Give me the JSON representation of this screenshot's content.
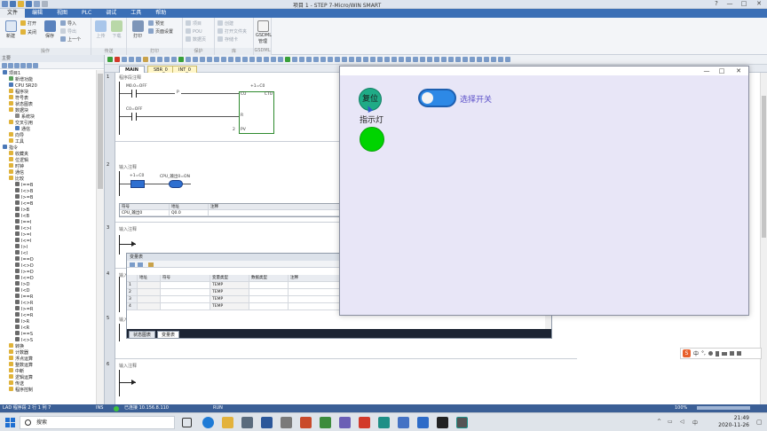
{
  "window": {
    "title": "项目 1 - STEP 7-Micro/WIN SMART",
    "controls": {
      "help": "?",
      "minimize": "—",
      "maximize": "□",
      "close": "✕"
    }
  },
  "menubar": {
    "items": [
      "文件",
      "编辑",
      "视图",
      "PLC",
      "调试",
      "工具",
      "帮助"
    ],
    "active_index": 0
  },
  "ribbon": {
    "new": "新建",
    "open": "打开",
    "close": "关闭",
    "save": "保存",
    "import": "导入",
    "export": "导出",
    "previous": "上一个",
    "group_ops": "操作",
    "upload": "上传",
    "download": "下载",
    "group_transfer": "传送",
    "print": "打印",
    "preview": "预览",
    "page_setup": "页面设置",
    "group_print": "打印",
    "protect_pou": "POU",
    "protect_data": "数据页",
    "protect_project": "项目",
    "group_protect": "保护",
    "create": "创建",
    "open_library": "打开文件夹",
    "storage": "存储卡",
    "group_library": "库",
    "gsdml": "GSDML 管理",
    "group_gsdml": "GSDML"
  },
  "project_panel": {
    "header": "主要",
    "tree": [
      {
        "label": "项目1",
        "level": 0,
        "color": "#4a78b8"
      },
      {
        "label": "新增功能",
        "level": 1,
        "color": "#5aa05a"
      },
      {
        "label": "CPU SR20",
        "level": 1,
        "color": "#4a78b8"
      },
      {
        "label": "程序块",
        "level": 1,
        "color": "#e0b33a"
      },
      {
        "label": "符号表",
        "level": 1,
        "color": "#e0b33a"
      },
      {
        "label": "状态图表",
        "level": 1,
        "color": "#e0b33a"
      },
      {
        "label": "数据块",
        "level": 1,
        "color": "#e0b33a"
      },
      {
        "label": "系统块",
        "level": 2,
        "color": "#888888"
      },
      {
        "label": "交叉引用",
        "level": 1,
        "color": "#e0b33a"
      },
      {
        "label": "通信",
        "level": 2,
        "color": "#4a78b8"
      },
      {
        "label": "向导",
        "level": 1,
        "color": "#e0b33a"
      },
      {
        "label": "工具",
        "level": 1,
        "color": "#e0b33a"
      },
      {
        "label": "指令",
        "level": 0,
        "color": "#4a78b8"
      },
      {
        "label": "收藏夹",
        "level": 1,
        "color": "#e0b33a"
      },
      {
        "label": "位逻辑",
        "level": 1,
        "color": "#e0b33a"
      },
      {
        "label": "时钟",
        "level": 1,
        "color": "#e0b33a"
      },
      {
        "label": "通信",
        "level": 1,
        "color": "#e0b33a"
      },
      {
        "label": "比较",
        "level": 1,
        "color": "#e0b33a"
      },
      {
        "label": "I==B",
        "level": 2,
        "color": "#6a6a6a"
      },
      {
        "label": "I<>B",
        "level": 2,
        "color": "#6a6a6a"
      },
      {
        "label": "I>=B",
        "level": 2,
        "color": "#6a6a6a"
      },
      {
        "label": "I<=B",
        "level": 2,
        "color": "#6a6a6a"
      },
      {
        "label": "I>B",
        "level": 2,
        "color": "#6a6a6a"
      },
      {
        "label": "I<B",
        "level": 2,
        "color": "#6a6a6a"
      },
      {
        "label": "I==I",
        "level": 2,
        "color": "#6a6a6a"
      },
      {
        "label": "I<>I",
        "level": 2,
        "color": "#6a6a6a"
      },
      {
        "label": "I>=I",
        "level": 2,
        "color": "#6a6a6a"
      },
      {
        "label": "I<=I",
        "level": 2,
        "color": "#6a6a6a"
      },
      {
        "label": "I>I",
        "level": 2,
        "color": "#6a6a6a"
      },
      {
        "label": "I<I",
        "level": 2,
        "color": "#6a6a6a"
      },
      {
        "label": "I==D",
        "level": 2,
        "color": "#6a6a6a"
      },
      {
        "label": "I<>D",
        "level": 2,
        "color": "#6a6a6a"
      },
      {
        "label": "I>=D",
        "level": 2,
        "color": "#6a6a6a"
      },
      {
        "label": "I<=D",
        "level": 2,
        "color": "#6a6a6a"
      },
      {
        "label": "I>D",
        "level": 2,
        "color": "#6a6a6a"
      },
      {
        "label": "I<D",
        "level": 2,
        "color": "#6a6a6a"
      },
      {
        "label": "I==R",
        "level": 2,
        "color": "#6a6a6a"
      },
      {
        "label": "I<>R",
        "level": 2,
        "color": "#6a6a6a"
      },
      {
        "label": "I>=R",
        "level": 2,
        "color": "#6a6a6a"
      },
      {
        "label": "I<=R",
        "level": 2,
        "color": "#6a6a6a"
      },
      {
        "label": "I>R",
        "level": 2,
        "color": "#6a6a6a"
      },
      {
        "label": "I<R",
        "level": 2,
        "color": "#6a6a6a"
      },
      {
        "label": "I==S",
        "level": 2,
        "color": "#6a6a6a"
      },
      {
        "label": "I<>S",
        "level": 2,
        "color": "#6a6a6a"
      },
      {
        "label": "转换",
        "level": 1,
        "color": "#e0b33a"
      },
      {
        "label": "计数器",
        "level": 1,
        "color": "#e0b33a"
      },
      {
        "label": "浮点运算",
        "level": 1,
        "color": "#e0b33a"
      },
      {
        "label": "整数运算",
        "level": 1,
        "color": "#e0b33a"
      },
      {
        "label": "中断",
        "level": 1,
        "color": "#e0b33a"
      },
      {
        "label": "逻辑运算",
        "level": 1,
        "color": "#e0b33a"
      },
      {
        "label": "传送",
        "level": 1,
        "color": "#e0b33a"
      },
      {
        "label": "程序控制",
        "level": 1,
        "color": "#e0b33a"
      }
    ]
  },
  "editor": {
    "tabs": [
      {
        "label": "MAIN",
        "active": true
      },
      {
        "label": "SBR_0",
        "active": false
      },
      {
        "label": "INT_0",
        "active": false
      }
    ],
    "networks": [
      {
        "num": "1",
        "comment": "程序段注释",
        "contact1": "M0.0=OFF",
        "contact1_tag": "P",
        "contact2": "C0=OFF",
        "counter_value": "+1=C0",
        "counter_type": "CTU",
        "pin_cu": "CU",
        "pin_r": "R",
        "pin_pv": "PV",
        "pv_value": "2"
      },
      {
        "num": "2",
        "comment": "输入注释",
        "contact": "+1=C0",
        "coil": "CPU_输出0=ON",
        "symtable": {
          "headers": [
            "符号",
            "地址",
            "注释"
          ],
          "rows": [
            [
              "CPU_输出0",
              "Q0.0",
              ""
            ]
          ]
        }
      },
      {
        "num": "3",
        "comment": "输入注释"
      },
      {
        "num": "4",
        "comment": "输入注释"
      },
      {
        "num": "5",
        "comment": "输入注释"
      },
      {
        "num": "6",
        "comment": "输入注释"
      }
    ]
  },
  "var_table": {
    "title": "变量表",
    "headers": [
      "",
      "地址",
      "符号",
      "变量类型",
      "数据类型",
      "注释"
    ],
    "rows": [
      {
        "n": "1",
        "type": "TEMP"
      },
      {
        "n": "2",
        "type": "TEMP"
      },
      {
        "n": "3",
        "type": "TEMP"
      },
      {
        "n": "4",
        "type": "TEMP"
      }
    ],
    "bottom_tabs": [
      {
        "label": "状态图表",
        "active": false
      },
      {
        "label": "变量表",
        "active": true
      }
    ]
  },
  "hmi_window": {
    "controls": {
      "minimize": "—",
      "maximize": "□",
      "close": "✕"
    },
    "reset_button": "复位",
    "lamp_label": "指示灯",
    "lamp_color": "#00d400",
    "toggle_label": "选择开关",
    "toggle_on": true
  },
  "statusbar": {
    "position": "LAD 程序段 2 行 1 列 7",
    "mode": "INS",
    "connection": "已连接 10.156.8.110",
    "run": "RUN",
    "zoom": "100%"
  },
  "ime": {
    "lang": "中",
    "punct": "°,"
  },
  "taskbar": {
    "search_placeholder": "搜索",
    "time": "21:49",
    "date": "2020-11-26"
  }
}
